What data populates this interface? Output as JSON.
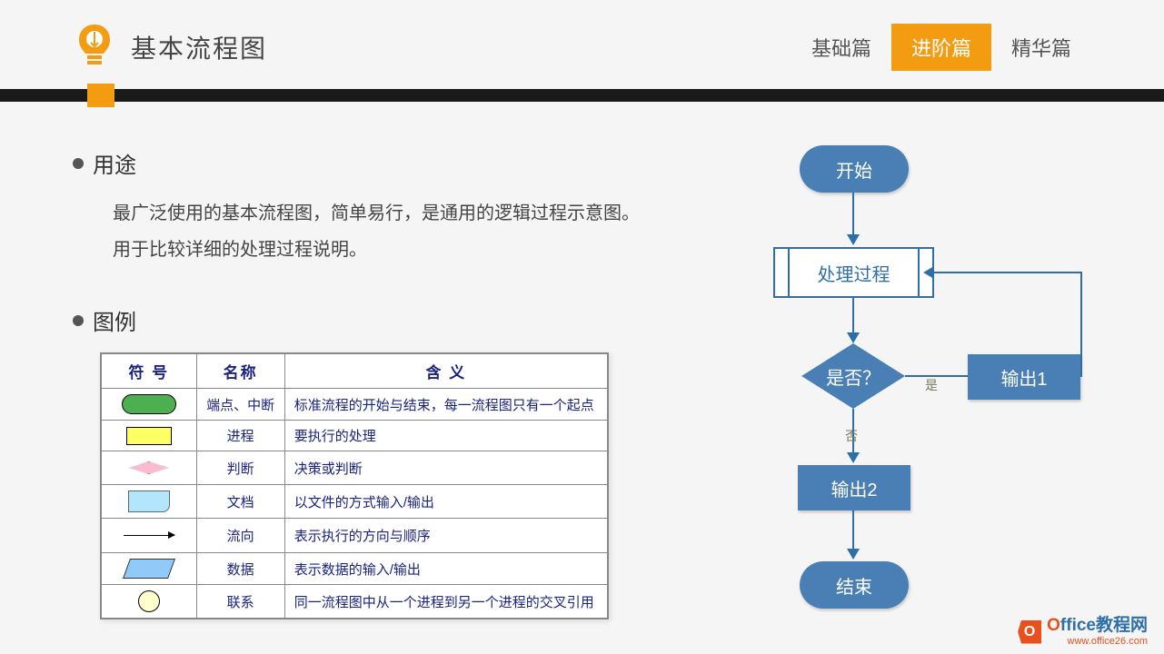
{
  "header": {
    "title": "基本流程图",
    "tabs": [
      "基础篇",
      "进阶篇",
      "精华篇"
    ],
    "active_tab_index": 1
  },
  "sections": {
    "usage": {
      "heading": "用途",
      "line1": "最广泛使用的基本流程图，简单易行，是通用的逻辑过程示意图。",
      "line2": "用于比较详细的处理过程说明。"
    },
    "legend": {
      "heading": "图例",
      "columns": [
        "符 号",
        "名称",
        "含 义"
      ],
      "rows": [
        {
          "shape": "terminal",
          "name": "端点、中断",
          "meaning": "标准流程的开始与结束，每一流程图只有一个起点"
        },
        {
          "shape": "process",
          "name": "进程",
          "meaning": "要执行的处理"
        },
        {
          "shape": "decision",
          "name": "判断",
          "meaning": "决策或判断"
        },
        {
          "shape": "document",
          "name": "文档",
          "meaning": "以文件的方式输入/输出"
        },
        {
          "shape": "arrow",
          "name": "流向",
          "meaning": "表示执行的方向与顺序"
        },
        {
          "shape": "data",
          "name": "数据",
          "meaning": "表示数据的输入/输出"
        },
        {
          "shape": "connector",
          "name": "联系",
          "meaning": "同一流程图中从一个进程到另一个进程的交叉引用"
        }
      ]
    }
  },
  "flowchart": {
    "start": "开始",
    "process": "处理过程",
    "decision": "是否？",
    "decision_yes_label": "是",
    "decision_no_label": "否",
    "output1": "输出1",
    "output2": "输出2",
    "end": "结束"
  },
  "watermark": {
    "icon_letter": "O",
    "brand_first": "O",
    "brand_rest": "ffice教程网",
    "url": "www.office26.com"
  },
  "colors": {
    "accent_orange": "#f39c12",
    "flow_blue": "#4a7fb5",
    "wm_orange": "#e8501e"
  }
}
